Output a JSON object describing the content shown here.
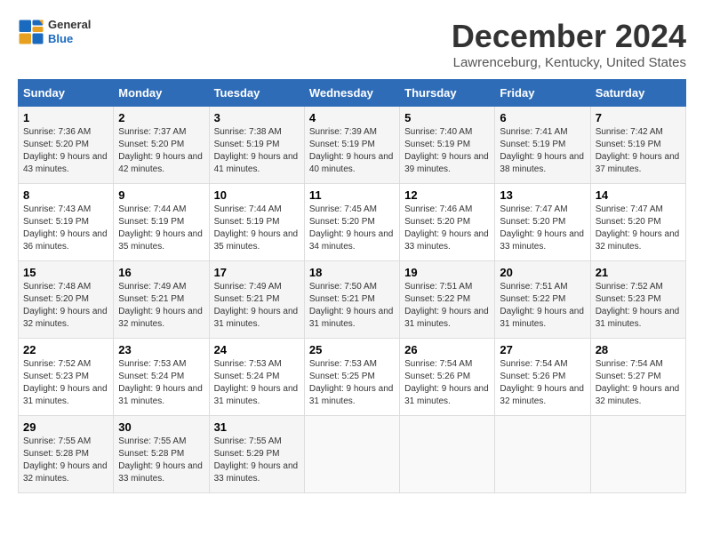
{
  "header": {
    "logo_line1": "General",
    "logo_line2": "Blue",
    "title": "December 2024",
    "subtitle": "Lawrenceburg, Kentucky, United States"
  },
  "calendar": {
    "headers": [
      "Sunday",
      "Monday",
      "Tuesday",
      "Wednesday",
      "Thursday",
      "Friday",
      "Saturday"
    ],
    "weeks": [
      [
        null,
        {
          "day": "2",
          "sunrise": "7:37 AM",
          "sunset": "5:20 PM",
          "daylight": "9 hours and 42 minutes."
        },
        {
          "day": "3",
          "sunrise": "7:38 AM",
          "sunset": "5:19 PM",
          "daylight": "9 hours and 41 minutes."
        },
        {
          "day": "4",
          "sunrise": "7:39 AM",
          "sunset": "5:19 PM",
          "daylight": "9 hours and 40 minutes."
        },
        {
          "day": "5",
          "sunrise": "7:40 AM",
          "sunset": "5:19 PM",
          "daylight": "9 hours and 39 minutes."
        },
        {
          "day": "6",
          "sunrise": "7:41 AM",
          "sunset": "5:19 PM",
          "daylight": "9 hours and 38 minutes."
        },
        {
          "day": "7",
          "sunrise": "7:42 AM",
          "sunset": "5:19 PM",
          "daylight": "9 hours and 37 minutes."
        }
      ],
      [
        {
          "day": "1",
          "sunrise": "7:36 AM",
          "sunset": "5:20 PM",
          "daylight": "9 hours and 43 minutes."
        },
        null,
        null,
        null,
        null,
        null,
        null
      ],
      [
        {
          "day": "8",
          "sunrise": "7:43 AM",
          "sunset": "5:19 PM",
          "daylight": "9 hours and 36 minutes."
        },
        {
          "day": "9",
          "sunrise": "7:44 AM",
          "sunset": "5:19 PM",
          "daylight": "9 hours and 35 minutes."
        },
        {
          "day": "10",
          "sunrise": "7:44 AM",
          "sunset": "5:19 PM",
          "daylight": "9 hours and 35 minutes."
        },
        {
          "day": "11",
          "sunrise": "7:45 AM",
          "sunset": "5:20 PM",
          "daylight": "9 hours and 34 minutes."
        },
        {
          "day": "12",
          "sunrise": "7:46 AM",
          "sunset": "5:20 PM",
          "daylight": "9 hours and 33 minutes."
        },
        {
          "day": "13",
          "sunrise": "7:47 AM",
          "sunset": "5:20 PM",
          "daylight": "9 hours and 33 minutes."
        },
        {
          "day": "14",
          "sunrise": "7:47 AM",
          "sunset": "5:20 PM",
          "daylight": "9 hours and 32 minutes."
        }
      ],
      [
        {
          "day": "15",
          "sunrise": "7:48 AM",
          "sunset": "5:20 PM",
          "daylight": "9 hours and 32 minutes."
        },
        {
          "day": "16",
          "sunrise": "7:49 AM",
          "sunset": "5:21 PM",
          "daylight": "9 hours and 32 minutes."
        },
        {
          "day": "17",
          "sunrise": "7:49 AM",
          "sunset": "5:21 PM",
          "daylight": "9 hours and 31 minutes."
        },
        {
          "day": "18",
          "sunrise": "7:50 AM",
          "sunset": "5:21 PM",
          "daylight": "9 hours and 31 minutes."
        },
        {
          "day": "19",
          "sunrise": "7:51 AM",
          "sunset": "5:22 PM",
          "daylight": "9 hours and 31 minutes."
        },
        {
          "day": "20",
          "sunrise": "7:51 AM",
          "sunset": "5:22 PM",
          "daylight": "9 hours and 31 minutes."
        },
        {
          "day": "21",
          "sunrise": "7:52 AM",
          "sunset": "5:23 PM",
          "daylight": "9 hours and 31 minutes."
        }
      ],
      [
        {
          "day": "22",
          "sunrise": "7:52 AM",
          "sunset": "5:23 PM",
          "daylight": "9 hours and 31 minutes."
        },
        {
          "day": "23",
          "sunrise": "7:53 AM",
          "sunset": "5:24 PM",
          "daylight": "9 hours and 31 minutes."
        },
        {
          "day": "24",
          "sunrise": "7:53 AM",
          "sunset": "5:24 PM",
          "daylight": "9 hours and 31 minutes."
        },
        {
          "day": "25",
          "sunrise": "7:53 AM",
          "sunset": "5:25 PM",
          "daylight": "9 hours and 31 minutes."
        },
        {
          "day": "26",
          "sunrise": "7:54 AM",
          "sunset": "5:26 PM",
          "daylight": "9 hours and 31 minutes."
        },
        {
          "day": "27",
          "sunrise": "7:54 AM",
          "sunset": "5:26 PM",
          "daylight": "9 hours and 32 minutes."
        },
        {
          "day": "28",
          "sunrise": "7:54 AM",
          "sunset": "5:27 PM",
          "daylight": "9 hours and 32 minutes."
        }
      ],
      [
        {
          "day": "29",
          "sunrise": "7:55 AM",
          "sunset": "5:28 PM",
          "daylight": "9 hours and 32 minutes."
        },
        {
          "day": "30",
          "sunrise": "7:55 AM",
          "sunset": "5:28 PM",
          "daylight": "9 hours and 33 minutes."
        },
        {
          "day": "31",
          "sunrise": "7:55 AM",
          "sunset": "5:29 PM",
          "daylight": "9 hours and 33 minutes."
        },
        null,
        null,
        null,
        null
      ]
    ],
    "labels": {
      "sunrise": "Sunrise:",
      "sunset": "Sunset:",
      "daylight": "Daylight:"
    }
  }
}
